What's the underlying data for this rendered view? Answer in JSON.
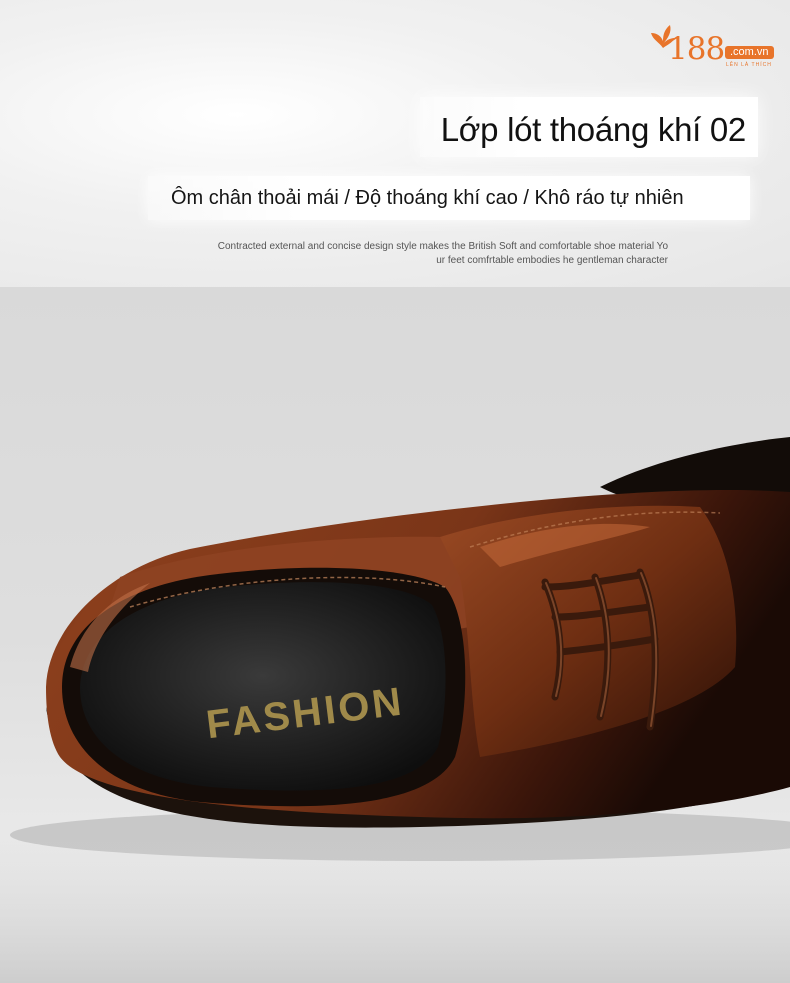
{
  "brand": {
    "logo_number": "188",
    "logo_domain": ".com.vn",
    "logo_tagline": "LÊN LÀ THÍCH",
    "accent_color": "#e8742a"
  },
  "banner": {
    "title": "Lớp lót thoáng khí 02",
    "subtitle": "Ôm chân thoải mái / Độ thoáng khí cao / Khô ráo tự nhiên",
    "description_line1": "Contracted external and concise design style makes the British Soft and comfortable shoe material Yo",
    "description_line2": "ur feet comfrtable embodies he gentleman character"
  },
  "product_photo": {
    "insole_print": "FASHION",
    "leather_color": "#7a3518"
  }
}
